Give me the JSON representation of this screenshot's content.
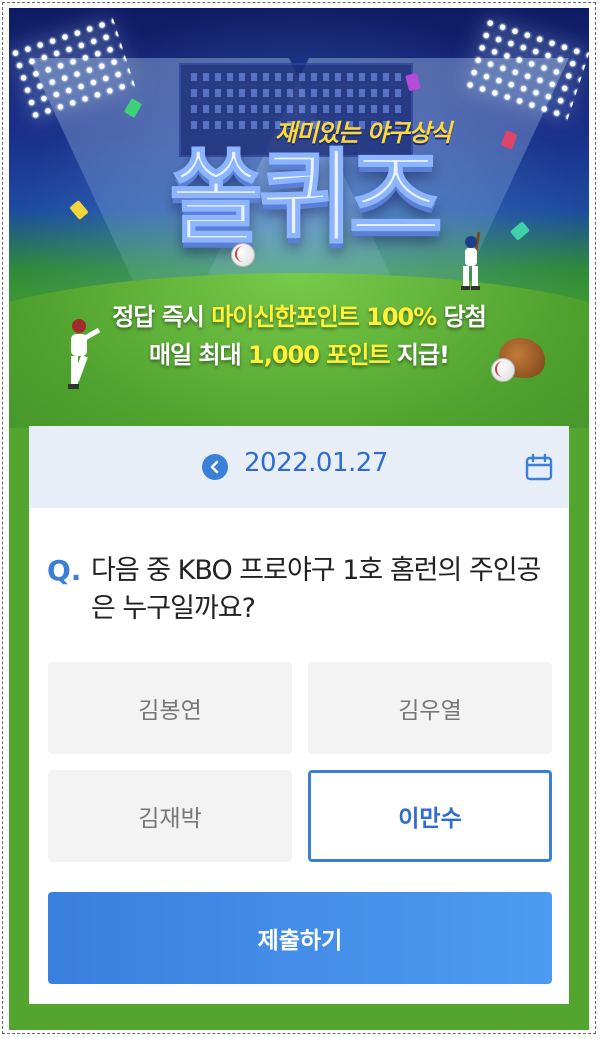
{
  "banner": {
    "subtitle": "재미있는 야구상식",
    "logo": "쏠퀴즈",
    "tagline1_plain_a": "정답 즉시 ",
    "tagline1_highlight": "마이신한포인트 100%",
    "tagline1_plain_b": " 당첨",
    "tagline2_plain_a": "매일 최대 ",
    "tagline2_highlight": "1,000 포인트",
    "tagline2_plain_b": " 지급!"
  },
  "quiz": {
    "date": "2022.01.27",
    "q_mark": "Q.",
    "question": "다음 중 KBO 프로야구 1호 홈런의 주인공은 누구일까요?",
    "options": [
      {
        "label": "김봉연",
        "selected": false
      },
      {
        "label": "김우열",
        "selected": false
      },
      {
        "label": "김재박",
        "selected": false
      },
      {
        "label": "이만수",
        "selected": true
      }
    ],
    "submit_label": "제출하기"
  },
  "icons": {
    "prev": "chevron-left-icon",
    "calendar": "calendar-icon"
  },
  "colors": {
    "accent": "#3b7fd9",
    "background": "#53a52f",
    "highlight": "#fff23a",
    "subtitle": "#ffd93a"
  }
}
